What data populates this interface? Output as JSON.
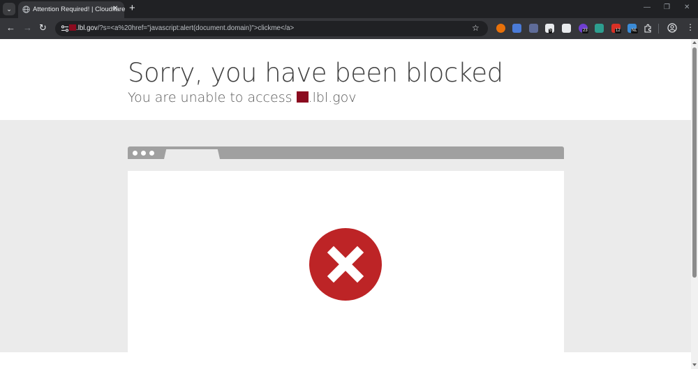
{
  "browser": {
    "tab_title": "Attention Required! | Cloudflare",
    "tab_close": "✕",
    "new_tab": "+",
    "tab_list": "⌄",
    "url_domain_suffix": ".lbl.gov",
    "url_path": "/?s=<a%20href=\"javascript:alert(document.domain)\">clickme</a>",
    "back": "←",
    "forward": "→",
    "reload": "↻",
    "bookmark_star": "☆",
    "minimize": "—",
    "restore": "❐",
    "close": "✕",
    "extensions": [
      {
        "name": "ext-orange",
        "color": "#e8710a"
      },
      {
        "name": "ext-translate",
        "color": "#4a7bd8"
      },
      {
        "name": "ext-shield",
        "color": "#5f6c99"
      },
      {
        "name": "ext-qr",
        "color": "#e8eaed",
        "badge": "5"
      },
      {
        "name": "ext-trash",
        "color": "#e8eaed"
      },
      {
        "name": "ext-purple",
        "color": "#6f3fd1",
        "badge": "23"
      },
      {
        "name": "ext-cloud",
        "color": "#2d9e8f"
      },
      {
        "name": "ext-calendar",
        "color": "#d93025",
        "badge": "12"
      },
      {
        "name": "ext-nl",
        "color": "#3b8bd6",
        "badge": "NL"
      }
    ],
    "puzzle_icon": "puzzle-icon",
    "profile_icon": "profile-icon",
    "menu_icon": "⋮"
  },
  "page": {
    "title": "Sorry, you have been blocked",
    "subtitle_prefix": "You are unable to access",
    "subtitle_domain_suffix": ".lbl.gov",
    "redaction_color": "#8b0b1f",
    "error_color": "#bd2426"
  }
}
